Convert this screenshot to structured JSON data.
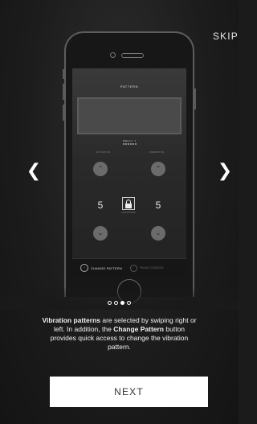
{
  "skip_label": "SKIP",
  "prev_icon": "chevron-left-icon",
  "next_icon": "chevron-right-icon",
  "phone": {
    "screen_title": "PATTERN",
    "pattern_label": "Pattern 1",
    "pattern_count": "1",
    "rotation_label": "ROTATION",
    "vibration_label": "VIBRATION",
    "rotation_value": "5",
    "vibration_value": "5",
    "lock_caption": "LINK ACTIONS",
    "change_pattern_label": "CHANGE PATTERN",
    "pause_label": "PAUSE CONSOLE"
  },
  "pager": {
    "count": 4,
    "active_index": 2
  },
  "description": {
    "bold1": "Vibration patterns",
    "text1": " are selected by swiping right or left. In addition, the ",
    "bold2": "Change Pattern",
    "text2": " button provides quick access to change the vibration pattern."
  },
  "next_label": "NEXT",
  "colors": {
    "background": "#1b1b1b",
    "text": "#f2f2f2",
    "button_bg": "#ffffff",
    "button_text": "#333333"
  }
}
